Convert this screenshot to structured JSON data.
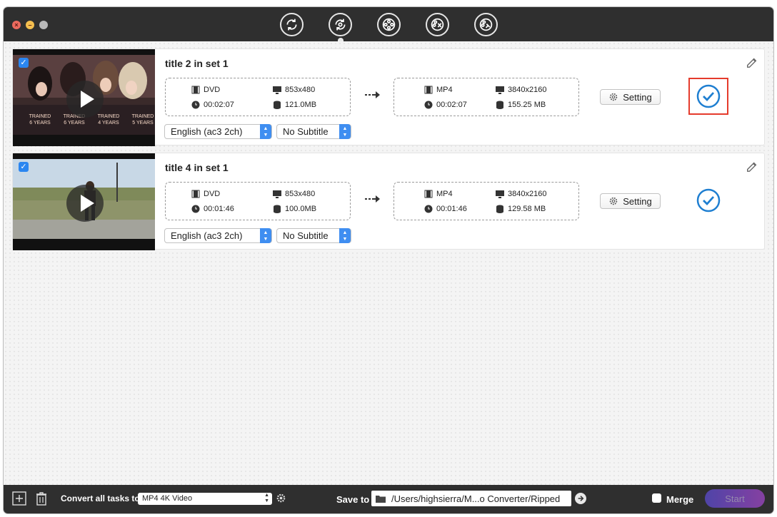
{
  "toolbar": {
    "nav_icons": [
      "dvd-ripper-icon",
      "video-converter-icon",
      "video-download-icon",
      "video-edit-icon",
      "video-toolbox-icon"
    ]
  },
  "tasks": [
    {
      "title": "title 2 in set 1",
      "checked": true,
      "thumbnail": "group-photo-thumbnail",
      "source": {
        "format": "DVD",
        "resolution": "853x480",
        "duration": "00:02:07",
        "size": "121.0MB"
      },
      "output": {
        "format": "MP4",
        "resolution": "3840x2160",
        "duration": "00:02:07",
        "size": "155.25 MB"
      },
      "setting_label": "Setting",
      "audio": "English (ac3 2ch)",
      "subtitle": "No Subtitle",
      "thumb_captions": [
        "TRAINED 6 YEARS",
        "TRAINED 6 YEARS",
        "TRAINED 4 YEARS",
        "TRAINED 5 YEARS"
      ]
    },
    {
      "title": "title 4 in set 1",
      "checked": true,
      "thumbnail": "outdoor-scene-thumbnail",
      "source": {
        "format": "DVD",
        "resolution": "853x480",
        "duration": "00:01:46",
        "size": "100.0MB"
      },
      "output": {
        "format": "MP4",
        "resolution": "3840x2160",
        "duration": "00:01:46",
        "size": "129.58 MB"
      },
      "setting_label": "Setting",
      "audio": "English (ac3 2ch)",
      "subtitle": "No Subtitle"
    }
  ],
  "bottom": {
    "convert_label": "Convert all tasks to",
    "convert_value": "MP4 4K Video",
    "save_label": "Save to",
    "save_path": "/Users/highsierra/M...o Converter/Ripped",
    "merge_label": "Merge",
    "start_label": "Start"
  },
  "colors": {
    "accent": "#2b86f0",
    "done": "#1f7fd1",
    "highlight": "#e53b2c",
    "bar": "#2f2f2f"
  }
}
